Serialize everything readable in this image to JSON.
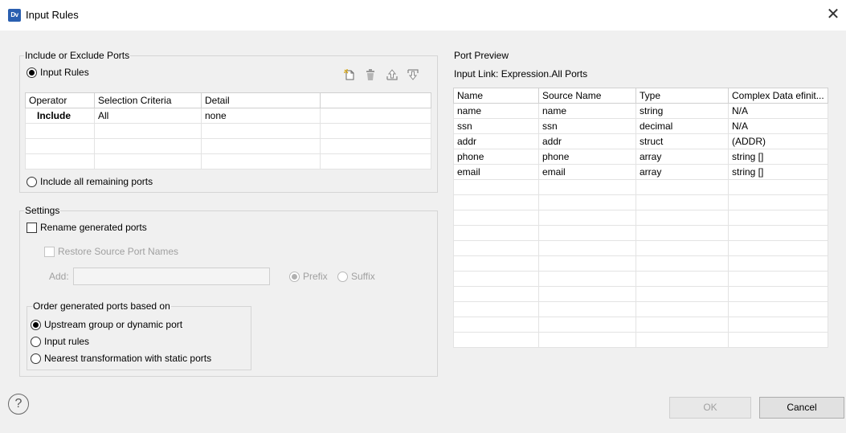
{
  "window": {
    "app_icon": "Dv",
    "title": "Input Rules",
    "close": "✕"
  },
  "include_group": {
    "title": "Include or Exclude Ports",
    "input_rules_label": "Input Rules",
    "toolbar_icons": [
      "new-rule-icon",
      "delete-icon",
      "move-up-icon",
      "move-down-icon"
    ],
    "columns": [
      "Operator",
      "Selection Criteria",
      "Detail",
      ""
    ],
    "rows": [
      [
        "Include",
        "All",
        "none",
        ""
      ],
      [
        "",
        "",
        "",
        ""
      ],
      [
        "",
        "",
        "",
        ""
      ],
      [
        "",
        "",
        "",
        ""
      ]
    ],
    "include_remaining_label": "Include all remaining ports"
  },
  "settings": {
    "title": "Settings",
    "rename_label": "Rename generated ports",
    "restore_label": "Restore Source Port Names",
    "add_label": "Add:",
    "add_value": "",
    "prefix_label": "Prefix",
    "suffix_label": "Suffix",
    "order_group": {
      "title": "Order generated ports based on",
      "options": [
        "Upstream group or dynamic port",
        "Input rules",
        "Nearest transformation with static ports"
      ],
      "selected_index": 0
    }
  },
  "preview": {
    "title": "Port Preview",
    "link_label": "Input Link: Expression.All Ports",
    "columns": [
      "Name",
      "Source Name",
      "Type",
      "Complex Data efinit..."
    ],
    "rows": [
      [
        "name",
        "name",
        "string",
        "N/A"
      ],
      [
        "ssn",
        "ssn",
        "decimal",
        "N/A"
      ],
      [
        "addr",
        "addr",
        "struct",
        "(ADDR)"
      ],
      [
        "phone",
        "phone",
        "array",
        "string []"
      ],
      [
        "email",
        "email",
        "array",
        "string []"
      ]
    ],
    "empty_row_count": 11
  },
  "footer": {
    "help": "?",
    "ok_label": "OK",
    "cancel_label": "Cancel"
  }
}
